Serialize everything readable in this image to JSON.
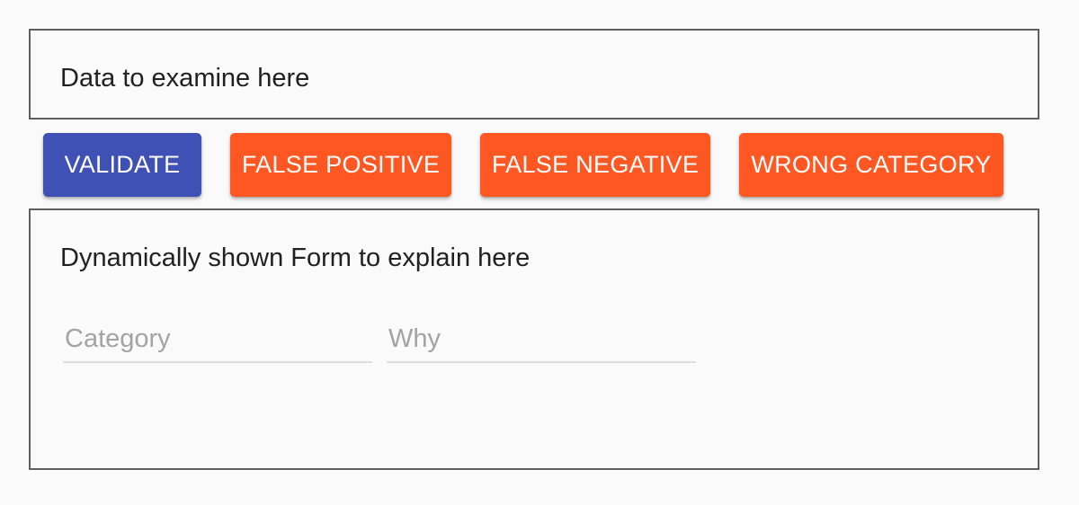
{
  "data_panel": {
    "text": "Data to examine here"
  },
  "actions": {
    "validate": "VALIDATE",
    "false_positive": "FALSE POSITIVE",
    "false_negative": "FALSE NEGATIVE",
    "wrong_category": "WRONG CATEGORY"
  },
  "form_panel": {
    "title": "Dynamically shown Form to explain here",
    "category": {
      "placeholder": "Category",
      "value": ""
    },
    "why": {
      "placeholder": "Why",
      "value": ""
    }
  },
  "colors": {
    "primary": "#3f51b5",
    "accent": "#ff5722",
    "background": "#fafafa",
    "border": "#5f5f5f"
  }
}
